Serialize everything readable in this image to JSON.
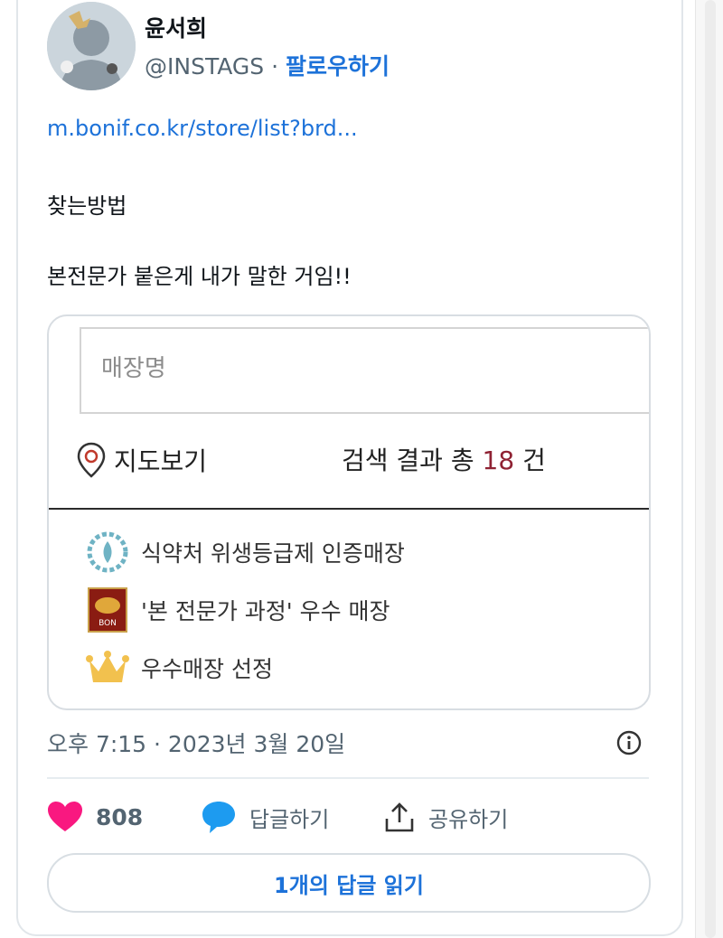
{
  "tweet": {
    "author_name": "윤서희",
    "handle": "@INSTAGS",
    "separator": "·",
    "follow_label": "팔로우하기",
    "link_text": "m.bonif.co.kr/store/list?brd...",
    "text_line1": "찾는방법",
    "text_line2": "본전문가 붙은게 내가 말한 거임!!"
  },
  "embed": {
    "search_placeholder": "매장명",
    "map_label": "지도보기",
    "result_prefix": "검색 결과 총",
    "result_count": "18",
    "result_suffix": "건",
    "legend": [
      {
        "label": "식약처 위생등급제 인증매장",
        "icon": "wreath-icon"
      },
      {
        "label": "'본 전문가 과정' 우수 매장",
        "icon": "bon-badge-icon",
        "badge_text": "BON"
      },
      {
        "label": "우수매장 선정",
        "icon": "crown-icon"
      }
    ],
    "colors": {
      "count": "#8f2233",
      "crown": "#f2c14e",
      "wreath": "#6fb3c4",
      "bon": "#8a1c12"
    }
  },
  "meta": {
    "timestamp": "오후 7:15 · 2023년 3월 20일"
  },
  "actions": {
    "like_count": "808",
    "reply_label": "답글하기",
    "share_label": "공유하기",
    "read_replies_label": "1개의 답글 읽기"
  },
  "colors": {
    "like": "#f91880",
    "reply": "#1d9bf0",
    "link": "#1d72d9",
    "muted": "#536471"
  }
}
